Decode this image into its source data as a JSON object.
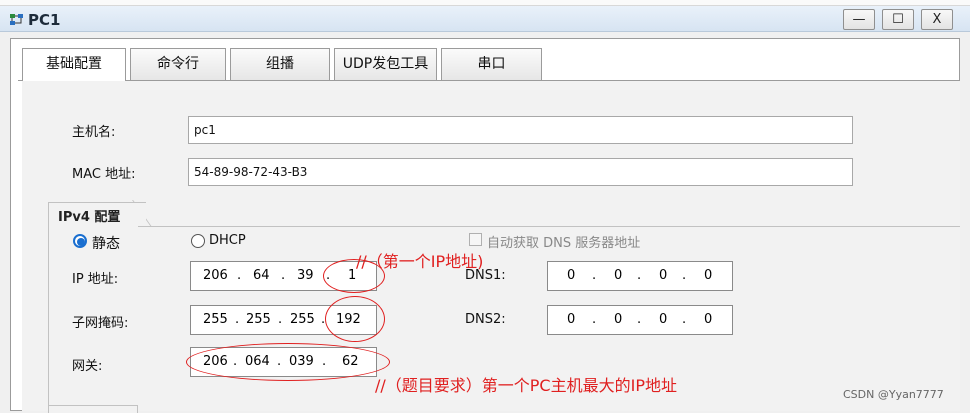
{
  "window": {
    "title": "PC1",
    "minimize": "—",
    "maximize": "☐",
    "close": "X"
  },
  "tabs": [
    {
      "label": "基础配置",
      "active": true
    },
    {
      "label": "命令行"
    },
    {
      "label": "组播"
    },
    {
      "label": "UDP发包工具"
    },
    {
      "label": "串口"
    }
  ],
  "form": {
    "hostname_label": "主机名:",
    "hostname_value": "pc1",
    "mac_label": "MAC 地址:",
    "mac_value": "54-89-98-72-43-B3"
  },
  "ipv4": {
    "group_label": "IPv4 配置",
    "static_label": "静态",
    "dhcp_label": "DHCP",
    "auto_dns_label": "自动获取 DNS 服务器地址",
    "ip_label": "IP 地址:",
    "ip": [
      "206",
      "64",
      "39",
      "1"
    ],
    "mask_label": "子网掩码:",
    "mask": [
      "255",
      "255",
      "255",
      "192"
    ],
    "gateway_label": "网关:",
    "gateway": [
      "206",
      "064",
      "039",
      "62"
    ],
    "dns1_label": "DNS1:",
    "dns1": [
      "0",
      "0",
      "0",
      "0"
    ],
    "dns2_label": "DNS2:",
    "dns2": [
      "0",
      "0",
      "0",
      "0"
    ],
    "dot": "."
  },
  "annotations": {
    "ip_note": "//（第一个IP地址)",
    "gateway_note": "//（题目要求）第一个PC主机最大的IP地址"
  },
  "watermark": "CSDN @Yyan7777",
  "colors": {
    "annotation": "#e02020",
    "radio_selected": "#1a6fd0"
  }
}
